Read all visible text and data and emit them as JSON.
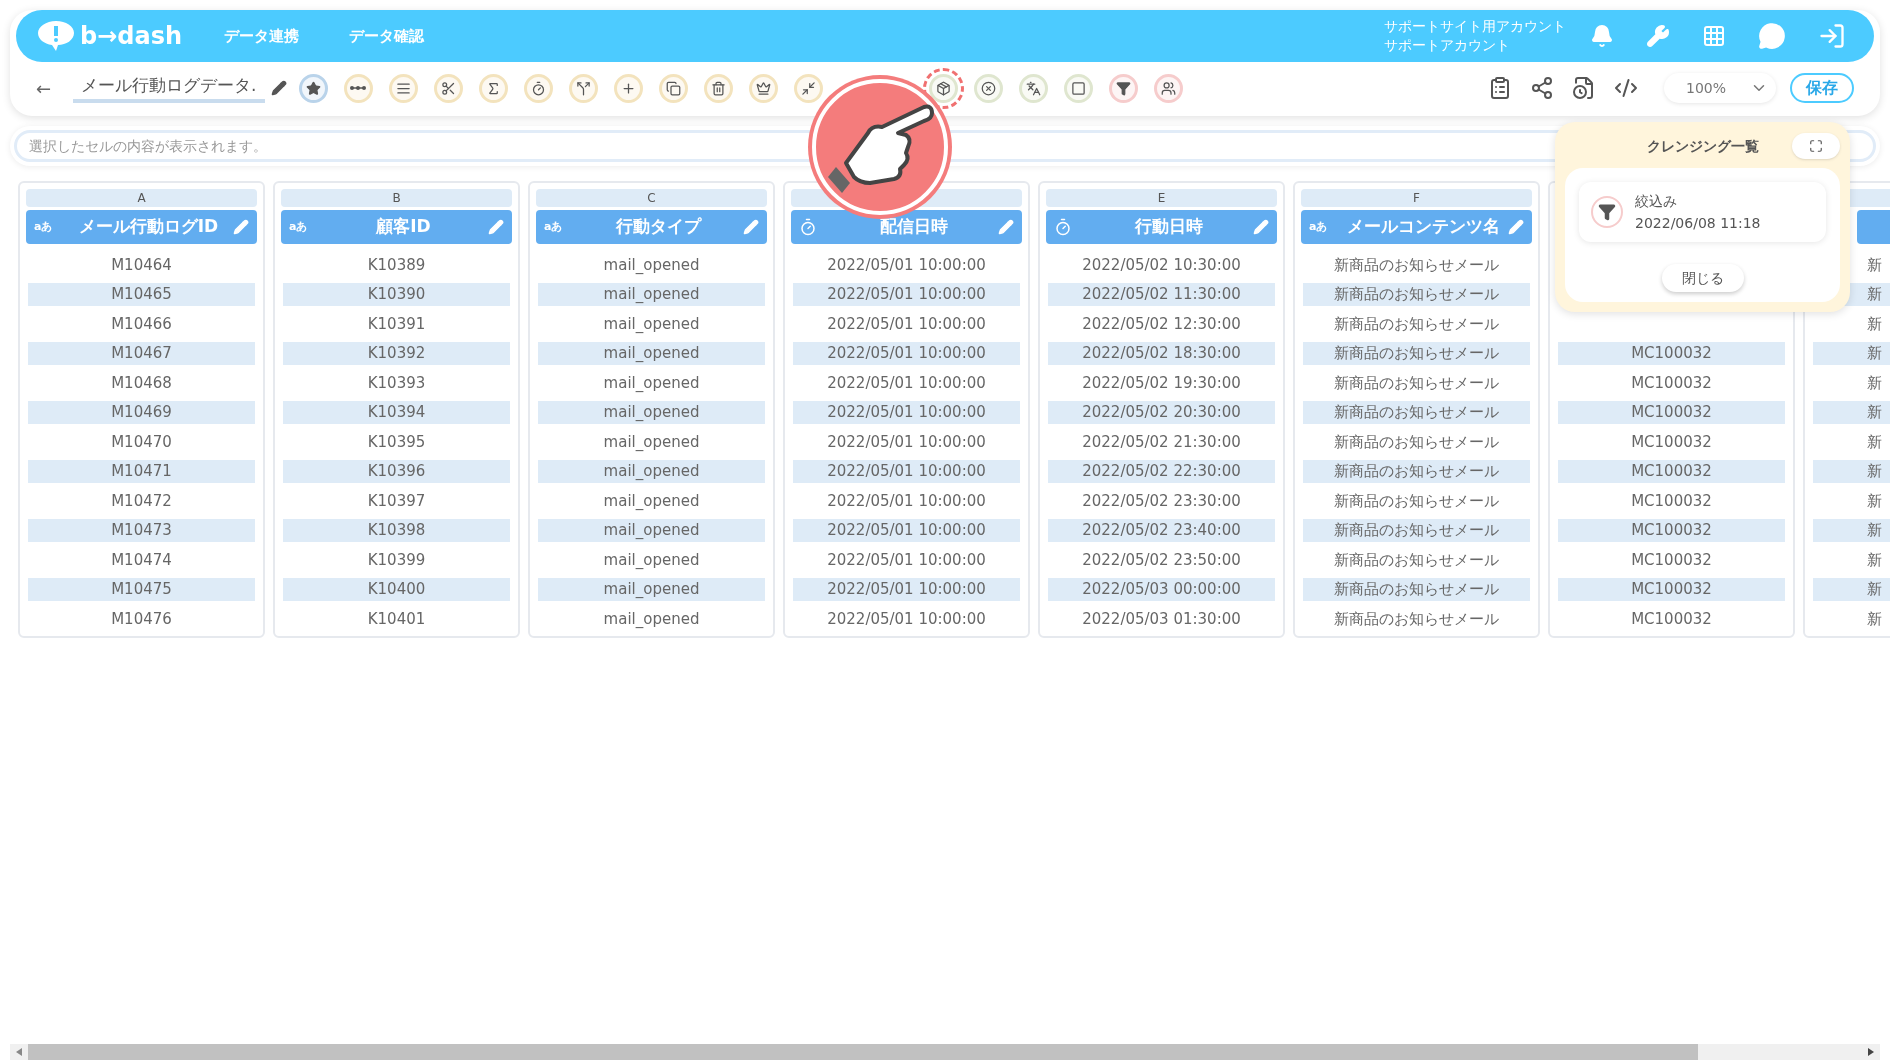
{
  "header": {
    "logo": "b→dash",
    "nav": [
      "データ連携",
      "データ確認"
    ],
    "account": [
      "サポートサイト用アカウント",
      "サポートアカウント"
    ]
  },
  "toolbar": {
    "back": "←",
    "title": "メール行動ログデータ.",
    "tools": [
      {
        "kind": "star",
        "color": "#b9d3ea",
        "highlighted": false
      },
      {
        "kind": "dots",
        "color": "#f3e3bd",
        "highlighted": false
      },
      {
        "kind": "lines",
        "color": "#f3e3bd",
        "highlighted": false
      },
      {
        "kind": "scissors",
        "color": "#f3e3bd",
        "highlighted": false
      },
      {
        "kind": "math",
        "color": "#f3e3bd",
        "highlighted": false
      },
      {
        "kind": "timer",
        "color": "#f3e3bd",
        "highlighted": false
      },
      {
        "kind": "split",
        "color": "#f3e3bd",
        "highlighted": false
      },
      {
        "kind": "plus",
        "color": "#f3e3bd",
        "highlighted": false
      },
      {
        "kind": "copy",
        "color": "#f3e3bd",
        "highlighted": false
      },
      {
        "kind": "trash",
        "color": "#f3e3bd",
        "highlighted": false
      },
      {
        "kind": "crown",
        "color": "#f3e3bd",
        "highlighted": false
      },
      {
        "kind": "shrink",
        "color": "#f3e3bd",
        "highlighted": false
      },
      {
        "kind": "package",
        "color": "#dfe6cf",
        "highlighted": true
      },
      {
        "kind": "xcircle",
        "color": "#dfe6cf",
        "highlighted": false
      },
      {
        "kind": "translate",
        "color": "#dfe6cf",
        "highlighted": false
      },
      {
        "kind": "square",
        "color": "#dfe6cf",
        "highlighted": false
      },
      {
        "kind": "filter",
        "color": "#f6cccc",
        "highlighted": false
      },
      {
        "kind": "users",
        "color": "#f6cccc",
        "highlighted": false
      }
    ],
    "zoom": "100%",
    "save": "保存"
  },
  "cell_field": {
    "placeholder": "選択したセルの内容が表示されます。"
  },
  "table": {
    "columns": [
      {
        "letter": "A",
        "kind": "text",
        "type_label": "aあ",
        "title": "メール行動ログID",
        "cells": [
          "M10464",
          "M10465",
          "M10466",
          "M10467",
          "M10468",
          "M10469",
          "M10470",
          "M10471",
          "M10472",
          "M10473",
          "M10474",
          "M10475",
          "M10476"
        ]
      },
      {
        "letter": "B",
        "kind": "text",
        "type_label": "aあ",
        "title": "顧客ID",
        "cells": [
          "K10389",
          "K10390",
          "K10391",
          "K10392",
          "K10393",
          "K10394",
          "K10395",
          "K10396",
          "K10397",
          "K10398",
          "K10399",
          "K10400",
          "K10401"
        ]
      },
      {
        "letter": "C",
        "kind": "text",
        "type_label": "aあ",
        "title": "行動タイプ",
        "cells": [
          "mail_opened",
          "mail_opened",
          "mail_opened",
          "mail_opened",
          "mail_opened",
          "mail_opened",
          "mail_opened",
          "mail_opened",
          "mail_opened",
          "mail_opened",
          "mail_opened",
          "mail_opened",
          "mail_opened"
        ]
      },
      {
        "kind": "datetime",
        "title": "配信日時",
        "cells": [
          "2022/05/01 10:00:00",
          "2022/05/01 10:00:00",
          "2022/05/01 10:00:00",
          "2022/05/01 10:00:00",
          "2022/05/01 10:00:00",
          "2022/05/01 10:00:00",
          "2022/05/01 10:00:00",
          "2022/05/01 10:00:00",
          "2022/05/01 10:00:00",
          "2022/05/01 10:00:00",
          "2022/05/01 10:00:00",
          "2022/05/01 10:00:00",
          "2022/05/01 10:00:00"
        ]
      },
      {
        "letter": "E",
        "kind": "datetime",
        "title": "行動日時",
        "cells": [
          "2022/05/02 10:30:00",
          "2022/05/02 11:30:00",
          "2022/05/02 12:30:00",
          "2022/05/02 18:30:00",
          "2022/05/02 19:30:00",
          "2022/05/02 20:30:00",
          "2022/05/02 21:30:00",
          "2022/05/02 22:30:00",
          "2022/05/02 23:30:00",
          "2022/05/02 23:40:00",
          "2022/05/02 23:50:00",
          "2022/05/03 00:00:00",
          "2022/05/03 01:30:00"
        ]
      },
      {
        "letter": "F",
        "kind": "text",
        "type_label": "aあ",
        "title": "メールコンテンツ名",
        "cells": [
          "新商品のお知らせメール",
          "新商品のお知らせメール",
          "新商品のお知らせメール",
          "新商品のお知らせメール",
          "新商品のお知らせメール",
          "新商品のお知らせメール",
          "新商品のお知らせメール",
          "新商品のお知らせメール",
          "新商品のお知らせメール",
          "新商品のお知らせメール",
          "新商品のお知らせメール",
          "新商品のお知らせメール",
          "新商品のお知らせメール"
        ]
      },
      {
        "kind": "hidden",
        "cells": [
          null,
          null,
          null,
          "MC100032",
          "MC100032",
          "MC100032",
          "MC100032",
          "MC100032",
          "MC100032",
          "MC100032",
          "MC100032",
          "MC100032",
          "MC100032"
        ]
      },
      {
        "kind": "partial",
        "cells": [
          "新",
          "新",
          "新",
          "新",
          "新",
          "新",
          "新",
          "新",
          "新",
          "新",
          "新",
          "新",
          "新"
        ]
      }
    ]
  },
  "cleansing_panel": {
    "title": "クレンジング一覧",
    "items": [
      {
        "kind": "filter",
        "name": "絞込み",
        "time": "2022/06/08 11:18"
      }
    ],
    "close": "閉じる"
  }
}
